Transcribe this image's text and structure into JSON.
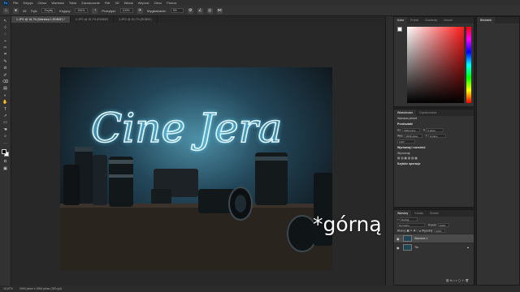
{
  "menu": {
    "items": [
      "Plik",
      "Edycja",
      "Obraz",
      "Warstwa",
      "Tekst",
      "Zaznaczanie",
      "Filtr",
      "3D",
      "Widok",
      "Wtyczki",
      "Okno",
      "Pomoc"
    ]
  },
  "options": {
    "mode_label": "Tryb:",
    "mode_value": "Zwykły",
    "opacity_label": "Kryjący:",
    "opacity_value": "100%",
    "flow_label": "Przepływ:",
    "flow_value": "100%",
    "smooth_label": "Wygładzanie:",
    "smooth_value": "0%",
    "brush_size": "45"
  },
  "tabs": [
    {
      "label": "1.JPG @ 16,7% (Warstwa 1,RGB/8*) *",
      "active": true
    },
    {
      "label": "2.JPG @ 16,7% (RGB/8*)",
      "active": false
    },
    {
      "label": "3.JPG @ 16,7% (RGB/8*)",
      "active": false
    }
  ],
  "tools": [
    "↖",
    "⊹",
    "◌",
    "⌁",
    "✂",
    "⌗",
    "✎",
    "⊘",
    "✐",
    "⌫",
    "▤",
    "◐",
    "✋",
    "T",
    "↗",
    "▭",
    "☚",
    "⌕",
    "⋯"
  ],
  "canvas": {
    "photo_text": "Cine Jera",
    "caption": "*górną"
  },
  "color_panel": {
    "tabs": [
      "Kolor",
      "Próbki",
      "Gradienty",
      "Wzorki"
    ]
  },
  "props_panel": {
    "tabs": [
      "Właściwości",
      "Dopasowania"
    ],
    "kind": "Warstwa pikseli",
    "section_transform": "Przekształć",
    "w_label": "Sz.",
    "w_value": "3990 pikse",
    "h_label": "Wys.",
    "h_value": "2659 pikse",
    "x_label": "X",
    "x_value": "0 pikse",
    "y_label": "Y",
    "y_value": "0 pikse",
    "angle_value": "0,00°",
    "section_align": "Wyrównaj i rozmieść",
    "align_label": "Wyrównaj:",
    "section_quick": "Szybkie operacje"
  },
  "layers_panel": {
    "tabs": [
      "Warstwy",
      "Kanały",
      "Ścieżki"
    ],
    "filter_label": "Rodzaj",
    "blend_mode": "Normalne",
    "opacity_label": "Krycie:",
    "opacity_value": "100%",
    "lock_label": "Blokuj:",
    "fill_label": "Wypełnij:",
    "fill_value": "100%",
    "layers": [
      {
        "name": "Warstwa 1",
        "selected": true
      },
      {
        "name": "Tło",
        "selected": false
      }
    ]
  },
  "libraries": {
    "title": "Biblioteki"
  },
  "status": {
    "zoom": "16,67%",
    "doc": "3990 pikse x 2659 pikse (300 ppi)"
  },
  "colors": {
    "accent": "#31a8ff",
    "neon": "#9fe8ff",
    "picker_hue": "#ff1a1a"
  }
}
